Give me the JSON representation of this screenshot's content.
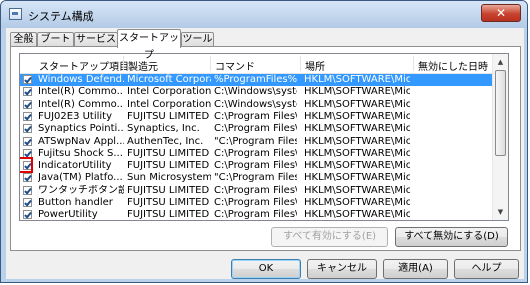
{
  "window": {
    "title": "システム構成",
    "close_label": "✕"
  },
  "tabs": [
    "全般",
    "ブート",
    "サービス",
    "スタートアップ",
    "ツール"
  ],
  "active_tab": 3,
  "columns": [
    "スタートアップ項目",
    "製造元",
    "コマンド",
    "場所",
    "無効にした日時"
  ],
  "rows": [
    [
      "Windows Defend...",
      "Microsoft Corporat...",
      "%ProgramFiles%\\W...",
      "HKLM\\SOFTWARE\\Micr..."
    ],
    [
      "Intel(R) Commo...",
      "Intel Corporation",
      "C:\\Windows\\syste...",
      "HKLM\\SOFTWARE\\Micr..."
    ],
    [
      "Intel(R) Commo...",
      "Intel Corporation",
      "C:\\Windows\\syste...",
      "HKLM\\SOFTWARE\\Micr..."
    ],
    [
      "FUJ02E3 Utility",
      "FUJITSU LIMITED",
      "C:\\Program Files\\...",
      "HKLM\\SOFTWARE\\Micr..."
    ],
    [
      "Synaptics Pointi...",
      "Synaptics, Inc.",
      "C:\\Program Files\\...",
      "HKLM\\SOFTWARE\\Micr..."
    ],
    [
      "ATSwpNav Appl...",
      "AuthenTec, Inc.",
      "\"C:\\Program Files...",
      "HKLM\\SOFTWARE\\Micr..."
    ],
    [
      "Fujitsu Shock S...",
      "FUJITSU LIMITED",
      "C:\\Program Files\\...",
      "HKLM\\SOFTWARE\\Micr..."
    ],
    [
      "IndicatorUtility",
      "FUJITSU LIMITED",
      "C:\\Program Files\\...",
      "HKLM\\SOFTWARE\\Micr..."
    ],
    [
      "Java(TM) Platfo...",
      "Sun Microsystems,...",
      "\"C:\\Program Files...",
      "HKLM\\SOFTWARE\\Micr..."
    ],
    [
      "ワンタッチボタン設...",
      "FUJITSU LIMITED",
      "C:\\Program Files\\...",
      "HKLM\\SOFTWARE\\Micr..."
    ],
    [
      "Button handler",
      "FUJITSU LIMITED",
      "C:\\Program Files\\...",
      "HKLM\\SOFTWARE\\Micr..."
    ],
    [
      "PowerUtility",
      "FUJITSU LIMITED",
      "C:\\Program Files\\...",
      "HKLM\\SOFTWARE\\Micr..."
    ]
  ],
  "selected_row": 0,
  "highlighted_row": 7,
  "checked": [
    true,
    true,
    true,
    true,
    true,
    true,
    true,
    true,
    true,
    true,
    true,
    true
  ],
  "buttons": {
    "enable_all": "すべて有効にする(E)",
    "disable_all": "すべて無効にする(D)",
    "ok": "OK",
    "cancel": "キャンセル",
    "apply": "適用(A)",
    "help": "ヘルプ"
  },
  "colors": {
    "selection": "#3399ff",
    "highlight_box": "#e00000",
    "close_button": "#c8432f"
  }
}
